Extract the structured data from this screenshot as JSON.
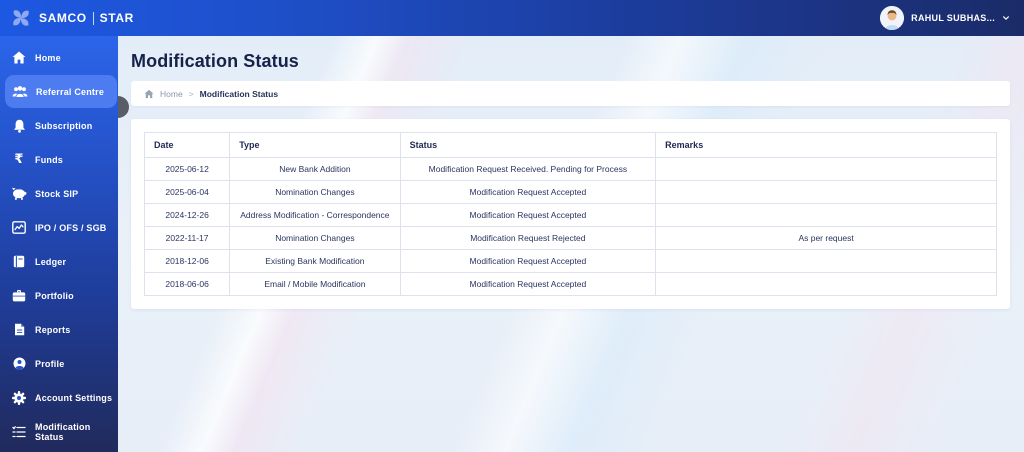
{
  "topbar": {
    "brand": {
      "primary": "SAMCO",
      "secondary": "STAR"
    },
    "user": {
      "name": "RAHUL SUBHAS..."
    }
  },
  "sidebar": {
    "items": [
      {
        "label": "Home",
        "icon": "home-icon",
        "active": false
      },
      {
        "label": "Referral Centre",
        "icon": "referral-centre-icon",
        "active": true
      },
      {
        "label": "Subscription",
        "icon": "bell-icon",
        "active": false
      },
      {
        "label": "Funds",
        "icon": "rupee-icon",
        "active": false
      },
      {
        "label": "Stock SIP",
        "icon": "piggy-bank-icon",
        "active": false
      },
      {
        "label": "IPO / OFS / SGB",
        "icon": "chart-icon",
        "active": false
      },
      {
        "label": "Ledger",
        "icon": "ledger-icon",
        "active": false
      },
      {
        "label": "Portfolio",
        "icon": "briefcase-icon",
        "active": false
      },
      {
        "label": "Reports",
        "icon": "report-icon",
        "active": false
      },
      {
        "label": "Profile",
        "icon": "profile-icon",
        "active": false
      },
      {
        "label": "Account Settings",
        "icon": "gear-icon",
        "active": false
      },
      {
        "label": "Modification Status",
        "icon": "checklist-icon",
        "active": false
      }
    ]
  },
  "page": {
    "title": "Modification Status",
    "breadcrumb": {
      "home": "Home",
      "separator": ">",
      "current": "Modification Status"
    }
  },
  "table": {
    "columns": [
      "Date",
      "Type",
      "Status",
      "Remarks"
    ],
    "rows": [
      [
        "2025-06-12",
        "New Bank Addition",
        "Modification Request Received. Pending for Process",
        ""
      ],
      [
        "2025-06-04",
        "Nomination Changes",
        "Modification Request Accepted",
        ""
      ],
      [
        "2024-12-26",
        "Address Modification - Correspondence",
        "Modification Request Accepted",
        ""
      ],
      [
        "2022-11-17",
        "Nomination Changes",
        "Modification Request Rejected",
        "As per request"
      ],
      [
        "2018-12-06",
        "Existing Bank Modification",
        "Modification Request Accepted",
        ""
      ],
      [
        "2018-06-06",
        "Email / Mobile Modification",
        "Modification Request Accepted",
        ""
      ]
    ]
  },
  "colors": {
    "topbar_gradient_start": "#1d58e2",
    "topbar_gradient_end": "#1b2b68",
    "sidebar_active": "#4c7cf0",
    "title_text": "#15224a",
    "table_border": "#dde2ee",
    "content_background": "#e6eef8"
  }
}
